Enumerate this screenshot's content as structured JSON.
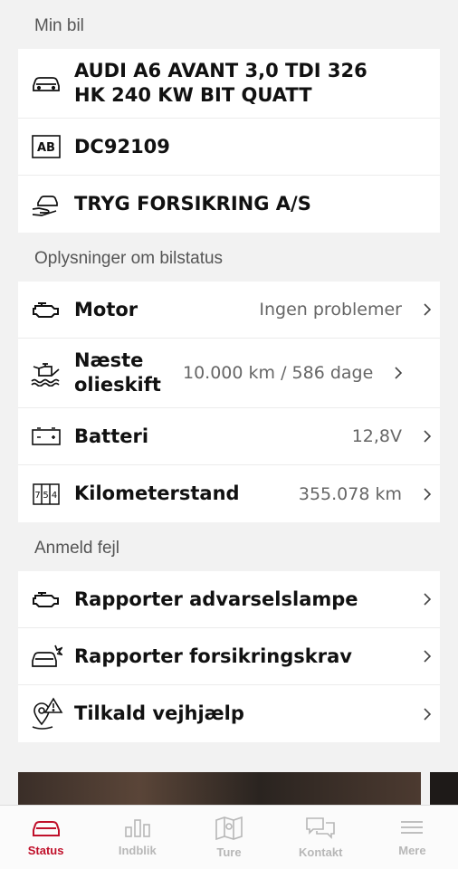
{
  "sections": {
    "my_car": "Min bil",
    "status_info": "Oplysninger om bilstatus",
    "report": "Anmeld fejl"
  },
  "car": {
    "model": "AUDI A6 AVANT 3,0 TDI 326 HK 240 KW BIT QUATT",
    "plate": "DC92109",
    "plate_icon_text": "AB",
    "insurer": "TRYG FORSIKRING A/S"
  },
  "status": {
    "motor": {
      "label": "Motor",
      "value": "Ingen problemer"
    },
    "oil": {
      "label": "Næste olieskift",
      "value": "10.000 km / 586 dage"
    },
    "battery": {
      "label": "Batteri",
      "value": "12,8V"
    },
    "odometer": {
      "label": "Kilometerstand",
      "value": "355.078 km"
    }
  },
  "report": {
    "warning_light": "Rapporter advarselslampe",
    "insurance_claim": "Rapporter forsikringskrav",
    "roadside": "Tilkald vejhjælp"
  },
  "tabs": [
    {
      "label": "Status",
      "icon": "car-icon",
      "active": true
    },
    {
      "label": "Indblik",
      "icon": "bar-chart-icon",
      "active": false
    },
    {
      "label": "Ture",
      "icon": "map-icon",
      "active": false
    },
    {
      "label": "Kontakt",
      "icon": "chat-icon",
      "active": false
    },
    {
      "label": "Mere",
      "icon": "menu-icon",
      "active": false
    }
  ],
  "colors": {
    "accent": "#c0102a",
    "inactive_tab": "#b7b7b7",
    "background": "#f2f2f2"
  }
}
